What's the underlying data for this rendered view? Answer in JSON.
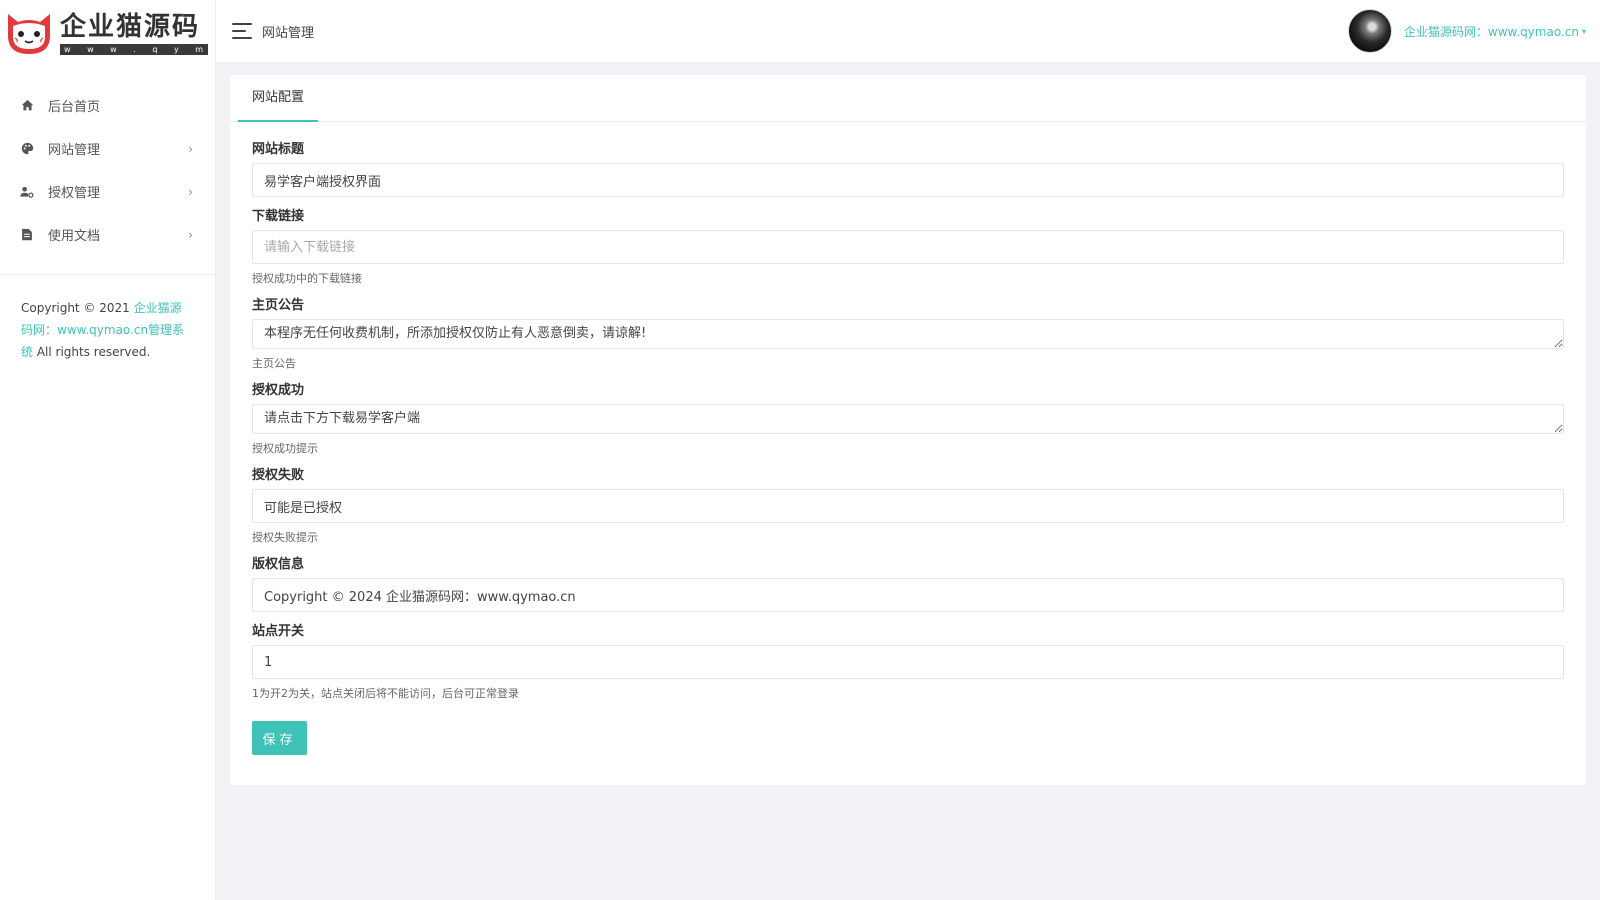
{
  "brand": {
    "title": "企业猫源码",
    "subtitle": "w w w . q y m a o . c n"
  },
  "sidebar": {
    "items": [
      {
        "label": "后台首页",
        "icon": "home-icon",
        "has_children": false
      },
      {
        "label": "网站管理",
        "icon": "palette-icon",
        "has_children": true
      },
      {
        "label": "授权管理",
        "icon": "user-gear-icon",
        "has_children": true
      },
      {
        "label": "使用文档",
        "icon": "document-icon",
        "has_children": true
      }
    ],
    "chevron": "›",
    "copyright_prefix": "Copyright © 2021 ",
    "copyright_link": "企业猫源码网：www.qymao.cn管理系统",
    "copyright_suffix": " All rights reserved."
  },
  "header": {
    "title": "网站管理",
    "user_name": "企业猫源码网：www.qymao.cn",
    "caret": "▾"
  },
  "tabs": [
    {
      "label": "网站配置",
      "active": true
    }
  ],
  "form": {
    "fields": [
      {
        "label": "网站标题",
        "type": "input",
        "value": "易学客户端授权界面",
        "placeholder": "",
        "help": ""
      },
      {
        "label": "下载链接",
        "type": "input",
        "value": "",
        "placeholder": "请输入下载链接",
        "help": "授权成功中的下载链接"
      },
      {
        "label": "主页公告",
        "type": "textarea",
        "value": "本程序无任何收费机制，所添加授权仅防止有人恶意倒卖，请谅解!",
        "placeholder": "",
        "help": "主页公告"
      },
      {
        "label": "授权成功",
        "type": "textarea",
        "value": "请点击下方下载易学客户端",
        "placeholder": "",
        "help": "授权成功提示"
      },
      {
        "label": "授权失败",
        "type": "input",
        "value": "可能是已授权",
        "placeholder": "",
        "help": "授权失败提示"
      },
      {
        "label": "版权信息",
        "type": "input",
        "value": "Copyright © 2024 企业猫源码网：www.qymao.cn",
        "placeholder": "",
        "help": ""
      },
      {
        "label": "站点开关",
        "type": "input",
        "value": "1",
        "placeholder": "",
        "help": "1为开2为关，站点关闭后将不能访问，后台可正常登录"
      }
    ],
    "save_label": "保存"
  },
  "colors": {
    "accent": "#3fc3b9",
    "logo_red": "#e4393c",
    "background": "#f1f3f6"
  }
}
